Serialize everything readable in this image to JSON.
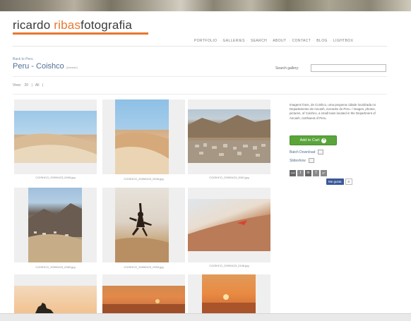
{
  "header": {
    "logo_word1": "ricardo ",
    "logo_word2": "ribas",
    "logo_word3": "fotografia"
  },
  "nav": {
    "items": [
      "PORTFOLIO",
      "GALLERIES",
      "SEARCH",
      "ABOUT",
      "CONTACT",
      "BLOG",
      "LIGHTBOX"
    ],
    "separator": "·"
  },
  "gallery": {
    "back_link": "Back to Peru",
    "title": "Peru - Coishco",
    "location_tag": "(Ancash)",
    "search_label": "Search gallery:",
    "search_value": "",
    "view_label": "View:",
    "view_option_1": "20",
    "view_option_2": "All",
    "view_sep": "|"
  },
  "thumbnails": [
    {
      "caption": "COISHCO_20090423_0006.jpg",
      "scene": "dune"
    },
    {
      "caption": "COISHCO_20090423_0045.jpg",
      "scene": "dune-tall"
    },
    {
      "caption": "COISHCO_20090423_0061.jpg",
      "scene": "town"
    },
    {
      "caption": "COISHCO_20090423_0083.jpg",
      "scene": "mountain"
    },
    {
      "caption": "COISHCO_20090423_0093.jpg",
      "scene": "jump"
    },
    {
      "caption": "COISHCO_20090423_0108.jpg",
      "scene": "slope"
    },
    {
      "caption": "",
      "scene": "sunset-silhouette"
    },
    {
      "caption": "",
      "scene": "sunset-sea"
    },
    {
      "caption": "",
      "scene": "sunset-sun"
    }
  ],
  "sidebar": {
    "description": "Imagens fotos, de Coishco, uma pequena cidade localizada no Departamento de Ancash, noroeste do Peru. / Images, photos, pictures, of Coishco, a small town located in the Department of Ancash, northwest of Peru.",
    "add_to_cart_label": "Add to Cart",
    "batch_download_label": "Batch Download",
    "slideshow_label": "Slideshow",
    "share_icons": [
      "mail",
      "t",
      "in",
      "f",
      "g+"
    ],
    "like_label": "Me gusta",
    "like_count": "0"
  },
  "colors": {
    "accent_orange": "#e8772e",
    "title_blue": "#4f6f93",
    "cart_green": "#5aa53a",
    "facebook_blue": "#3b5998"
  }
}
